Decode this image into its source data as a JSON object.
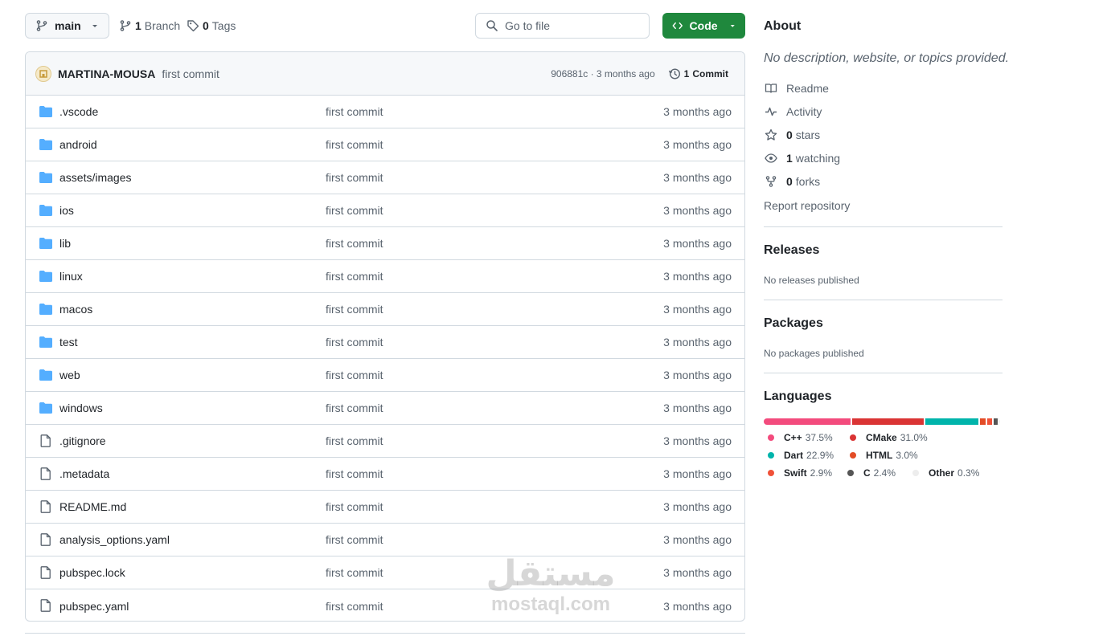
{
  "toolbar": {
    "branch": "main",
    "branches_count": "1",
    "branches_label": "Branch",
    "tags_count": "0",
    "tags_label": "Tags",
    "goto_placeholder": "Go to file",
    "code_label": "Code"
  },
  "latest_commit": {
    "author": "MARTINA-MOUSA",
    "message": "first commit",
    "hash_time": "906881c · 3 months ago",
    "commits_count": "1",
    "commits_label": "Commit"
  },
  "files": [
    {
      "type": "folder",
      "name": ".vscode",
      "message": "first commit",
      "date": "3 months ago"
    },
    {
      "type": "folder",
      "name": "android",
      "message": "first commit",
      "date": "3 months ago"
    },
    {
      "type": "folder",
      "name": "assets/images",
      "message": "first commit",
      "date": "3 months ago"
    },
    {
      "type": "folder",
      "name": "ios",
      "message": "first commit",
      "date": "3 months ago"
    },
    {
      "type": "folder",
      "name": "lib",
      "message": "first commit",
      "date": "3 months ago"
    },
    {
      "type": "folder",
      "name": "linux",
      "message": "first commit",
      "date": "3 months ago"
    },
    {
      "type": "folder",
      "name": "macos",
      "message": "first commit",
      "date": "3 months ago"
    },
    {
      "type": "folder",
      "name": "test",
      "message": "first commit",
      "date": "3 months ago"
    },
    {
      "type": "folder",
      "name": "web",
      "message": "first commit",
      "date": "3 months ago"
    },
    {
      "type": "folder",
      "name": "windows",
      "message": "first commit",
      "date": "3 months ago"
    },
    {
      "type": "file",
      "name": ".gitignore",
      "message": "first commit",
      "date": "3 months ago"
    },
    {
      "type": "file",
      "name": ".metadata",
      "message": "first commit",
      "date": "3 months ago"
    },
    {
      "type": "file",
      "name": "README.md",
      "message": "first commit",
      "date": "3 months ago"
    },
    {
      "type": "file",
      "name": "analysis_options.yaml",
      "message": "first commit",
      "date": "3 months ago"
    },
    {
      "type": "file",
      "name": "pubspec.lock",
      "message": "first commit",
      "date": "3 months ago"
    },
    {
      "type": "file",
      "name": "pubspec.yaml",
      "message": "first commit",
      "date": "3 months ago"
    }
  ],
  "about": {
    "title": "About",
    "description": "No description, website, or topics provided.",
    "readme": "Readme",
    "activity": "Activity",
    "stars_count": "0",
    "stars_label": "stars",
    "watching_count": "1",
    "watching_label": "watching",
    "forks_count": "0",
    "forks_label": "forks",
    "report": "Report repository"
  },
  "releases": {
    "title": "Releases",
    "subtitle": "No releases published"
  },
  "packages": {
    "title": "Packages",
    "subtitle": "No packages published"
  },
  "languages": {
    "title": "Languages",
    "items": [
      {
        "name": "C++",
        "percent": "37.5%",
        "value": 37.5,
        "color": "#f34b7d"
      },
      {
        "name": "CMake",
        "percent": "31.0%",
        "value": 31.0,
        "color": "#da3434"
      },
      {
        "name": "Dart",
        "percent": "22.9%",
        "value": 22.9,
        "color": "#00b4ab"
      },
      {
        "name": "HTML",
        "percent": "3.0%",
        "value": 3.0,
        "color": "#e34c26"
      },
      {
        "name": "Swift",
        "percent": "2.9%",
        "value": 2.9,
        "color": "#f05138"
      },
      {
        "name": "C",
        "percent": "2.4%",
        "value": 2.4,
        "color": "#555555"
      },
      {
        "name": "Other",
        "percent": "0.3%",
        "value": 0.3,
        "color": "#ededed"
      }
    ]
  },
  "watermark": {
    "arabic": "مستقل",
    "latin": "mostaql.com"
  }
}
